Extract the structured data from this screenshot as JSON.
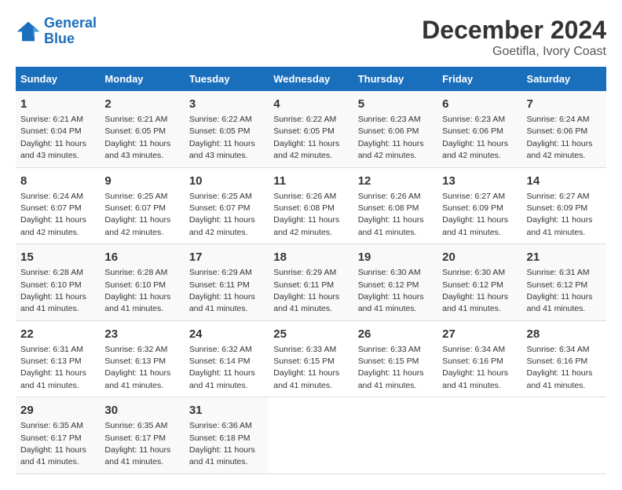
{
  "header": {
    "logo_text_general": "General",
    "logo_text_blue": "Blue",
    "main_title": "December 2024",
    "subtitle": "Goetifla, Ivory Coast"
  },
  "calendar": {
    "days_of_week": [
      "Sunday",
      "Monday",
      "Tuesday",
      "Wednesday",
      "Thursday",
      "Friday",
      "Saturday"
    ],
    "weeks": [
      [
        null,
        null,
        null,
        null,
        null,
        null,
        null
      ]
    ]
  },
  "days": {
    "week1": [
      {
        "num": "1",
        "sunrise": "6:21 AM",
        "sunset": "6:04 PM",
        "daylight": "11 hours and 43 minutes."
      },
      {
        "num": "2",
        "sunrise": "6:21 AM",
        "sunset": "6:05 PM",
        "daylight": "11 hours and 43 minutes."
      },
      {
        "num": "3",
        "sunrise": "6:22 AM",
        "sunset": "6:05 PM",
        "daylight": "11 hours and 43 minutes."
      },
      {
        "num": "4",
        "sunrise": "6:22 AM",
        "sunset": "6:05 PM",
        "daylight": "11 hours and 42 minutes."
      },
      {
        "num": "5",
        "sunrise": "6:23 AM",
        "sunset": "6:06 PM",
        "daylight": "11 hours and 42 minutes."
      },
      {
        "num": "6",
        "sunrise": "6:23 AM",
        "sunset": "6:06 PM",
        "daylight": "11 hours and 42 minutes."
      },
      {
        "num": "7",
        "sunrise": "6:24 AM",
        "sunset": "6:06 PM",
        "daylight": "11 hours and 42 minutes."
      }
    ],
    "week2": [
      {
        "num": "8",
        "sunrise": "6:24 AM",
        "sunset": "6:07 PM",
        "daylight": "11 hours and 42 minutes."
      },
      {
        "num": "9",
        "sunrise": "6:25 AM",
        "sunset": "6:07 PM",
        "daylight": "11 hours and 42 minutes."
      },
      {
        "num": "10",
        "sunrise": "6:25 AM",
        "sunset": "6:07 PM",
        "daylight": "11 hours and 42 minutes."
      },
      {
        "num": "11",
        "sunrise": "6:26 AM",
        "sunset": "6:08 PM",
        "daylight": "11 hours and 42 minutes."
      },
      {
        "num": "12",
        "sunrise": "6:26 AM",
        "sunset": "6:08 PM",
        "daylight": "11 hours and 41 minutes."
      },
      {
        "num": "13",
        "sunrise": "6:27 AM",
        "sunset": "6:09 PM",
        "daylight": "11 hours and 41 minutes."
      },
      {
        "num": "14",
        "sunrise": "6:27 AM",
        "sunset": "6:09 PM",
        "daylight": "11 hours and 41 minutes."
      }
    ],
    "week3": [
      {
        "num": "15",
        "sunrise": "6:28 AM",
        "sunset": "6:10 PM",
        "daylight": "11 hours and 41 minutes."
      },
      {
        "num": "16",
        "sunrise": "6:28 AM",
        "sunset": "6:10 PM",
        "daylight": "11 hours and 41 minutes."
      },
      {
        "num": "17",
        "sunrise": "6:29 AM",
        "sunset": "6:11 PM",
        "daylight": "11 hours and 41 minutes."
      },
      {
        "num": "18",
        "sunrise": "6:29 AM",
        "sunset": "6:11 PM",
        "daylight": "11 hours and 41 minutes."
      },
      {
        "num": "19",
        "sunrise": "6:30 AM",
        "sunset": "6:12 PM",
        "daylight": "11 hours and 41 minutes."
      },
      {
        "num": "20",
        "sunrise": "6:30 AM",
        "sunset": "6:12 PM",
        "daylight": "11 hours and 41 minutes."
      },
      {
        "num": "21",
        "sunrise": "6:31 AM",
        "sunset": "6:12 PM",
        "daylight": "11 hours and 41 minutes."
      }
    ],
    "week4": [
      {
        "num": "22",
        "sunrise": "6:31 AM",
        "sunset": "6:13 PM",
        "daylight": "11 hours and 41 minutes."
      },
      {
        "num": "23",
        "sunrise": "6:32 AM",
        "sunset": "6:13 PM",
        "daylight": "11 hours and 41 minutes."
      },
      {
        "num": "24",
        "sunrise": "6:32 AM",
        "sunset": "6:14 PM",
        "daylight": "11 hours and 41 minutes."
      },
      {
        "num": "25",
        "sunrise": "6:33 AM",
        "sunset": "6:15 PM",
        "daylight": "11 hours and 41 minutes."
      },
      {
        "num": "26",
        "sunrise": "6:33 AM",
        "sunset": "6:15 PM",
        "daylight": "11 hours and 41 minutes."
      },
      {
        "num": "27",
        "sunrise": "6:34 AM",
        "sunset": "6:16 PM",
        "daylight": "11 hours and 41 minutes."
      },
      {
        "num": "28",
        "sunrise": "6:34 AM",
        "sunset": "6:16 PM",
        "daylight": "11 hours and 41 minutes."
      }
    ],
    "week5": [
      {
        "num": "29",
        "sunrise": "6:35 AM",
        "sunset": "6:17 PM",
        "daylight": "11 hours and 41 minutes."
      },
      {
        "num": "30",
        "sunrise": "6:35 AM",
        "sunset": "6:17 PM",
        "daylight": "11 hours and 41 minutes."
      },
      {
        "num": "31",
        "sunrise": "6:36 AM",
        "sunset": "6:18 PM",
        "daylight": "11 hours and 41 minutes."
      }
    ]
  },
  "labels": {
    "sunrise_prefix": "Sunrise: ",
    "sunset_prefix": "Sunset: ",
    "daylight_prefix": "Daylight: "
  }
}
